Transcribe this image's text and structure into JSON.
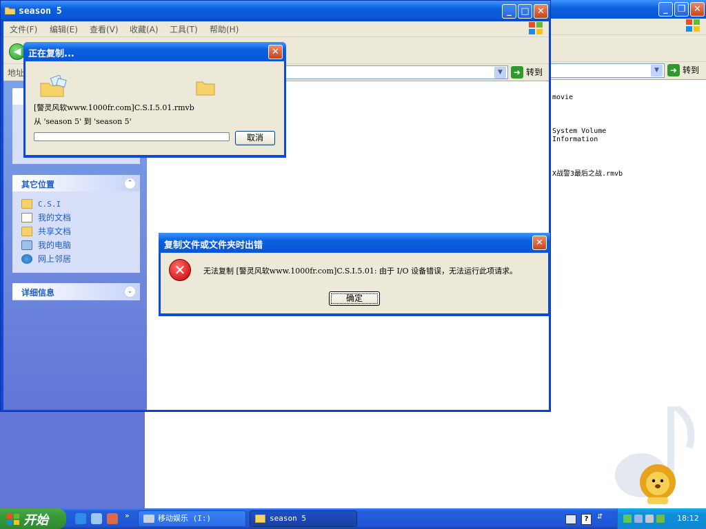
{
  "background_window": {
    "address_go_label": "转到",
    "files": [
      {
        "name": "movie"
      },
      {
        "name": "System Volume\nInformation"
      },
      {
        "name": "X战警3最后之战.rmvb"
      }
    ]
  },
  "main_window": {
    "title": "season 5",
    "menu": [
      "文件(F)",
      "编辑(E)",
      "查看(V)",
      "收藏(A)",
      "工具(T)",
      "帮助(H)"
    ],
    "address_label": "地址",
    "address_go_label": "转到",
    "panels": {
      "other_places": {
        "title": "其它位置",
        "items": [
          "C.S.I",
          "我的文档",
          "共享文档",
          "我的电脑",
          "网上邻居"
        ]
      },
      "details": {
        "title": "详细信息"
      }
    }
  },
  "copy_dialog": {
    "title": "正在复制...",
    "filename": "[警灵风软www.1000fr.com]C.S.I.5.01.rmvb",
    "from_to": "从 'season 5' 到 'season 5'",
    "progress": 0,
    "cancel_label": "取消"
  },
  "error_dialog": {
    "title": "复制文件或文件夹时出错",
    "message": "无法复制 [警灵风软www.1000fr.com]C.S.I.5.01: 由于 I/O 设备错误，无法运行此项请求。",
    "ok_label": "确定"
  },
  "taskbar": {
    "start_label": "开始",
    "buttons": [
      {
        "label": "移动娱乐 (I:)"
      },
      {
        "label": "season 5"
      }
    ],
    "clock": "18:12"
  },
  "colors": {
    "xp_blue": "#0a5fdc",
    "taskpane_link": "#215dc6",
    "start_green": "#379a37",
    "tray_blue": "#0f8ed8"
  }
}
